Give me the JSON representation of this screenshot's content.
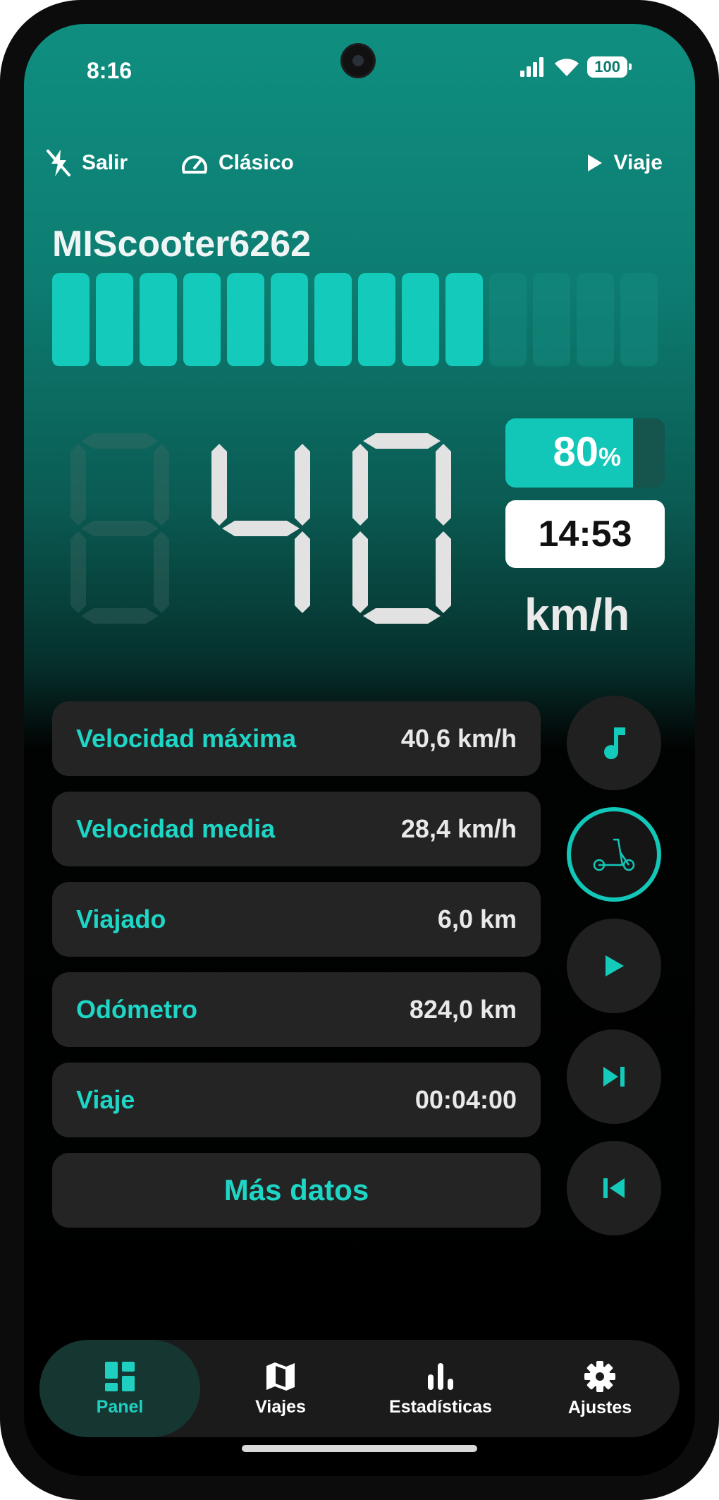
{
  "status_bar": {
    "time": "8:16",
    "battery": "100",
    "icons": [
      "signal-icon",
      "wifi-icon",
      "battery-icon"
    ]
  },
  "topbar": {
    "exit_label": "Salir",
    "exit_icon": "flash-off-icon",
    "mode_label": "Clásico",
    "mode_icon": "speedometer-icon",
    "trip_label": "Viaje",
    "trip_icon": "play-icon"
  },
  "device_name": "MIScooter6262",
  "power_bar": {
    "total_segments": 14,
    "active_segments": 10
  },
  "speed": {
    "digits": "040",
    "unit": "km/h"
  },
  "battery_percent": {
    "value": "80",
    "unit": "%",
    "level": 0.8
  },
  "clock": "14:53",
  "stats": [
    {
      "label": "Velocidad máxima",
      "value": "40,6 km/h"
    },
    {
      "label": "Velocidad media",
      "value": "28,4 km/h"
    },
    {
      "label": "Viajado",
      "value": "6,0 km"
    },
    {
      "label": "Odómetro",
      "value": "824,0 km"
    },
    {
      "label": "Viaje",
      "value": "00:04:00"
    }
  ],
  "more_data_label": "Más datos",
  "side_buttons": [
    "music-note-icon",
    "scooter-icon",
    "play-icon",
    "skip-next-icon",
    "skip-previous-icon"
  ],
  "nav": {
    "items": [
      {
        "label": "Panel",
        "icon": "dashboard-icon",
        "selected": true
      },
      {
        "label": "Viajes",
        "icon": "map-icon",
        "selected": false
      },
      {
        "label": "Estadísticas",
        "icon": "bar-chart-icon",
        "selected": false
      },
      {
        "label": "Ajustes",
        "icon": "gear-icon",
        "selected": false
      }
    ]
  },
  "colors": {
    "accent": "#12c7b8",
    "card": "#242424",
    "background": "#000000",
    "header_top": "#0f8f80"
  }
}
